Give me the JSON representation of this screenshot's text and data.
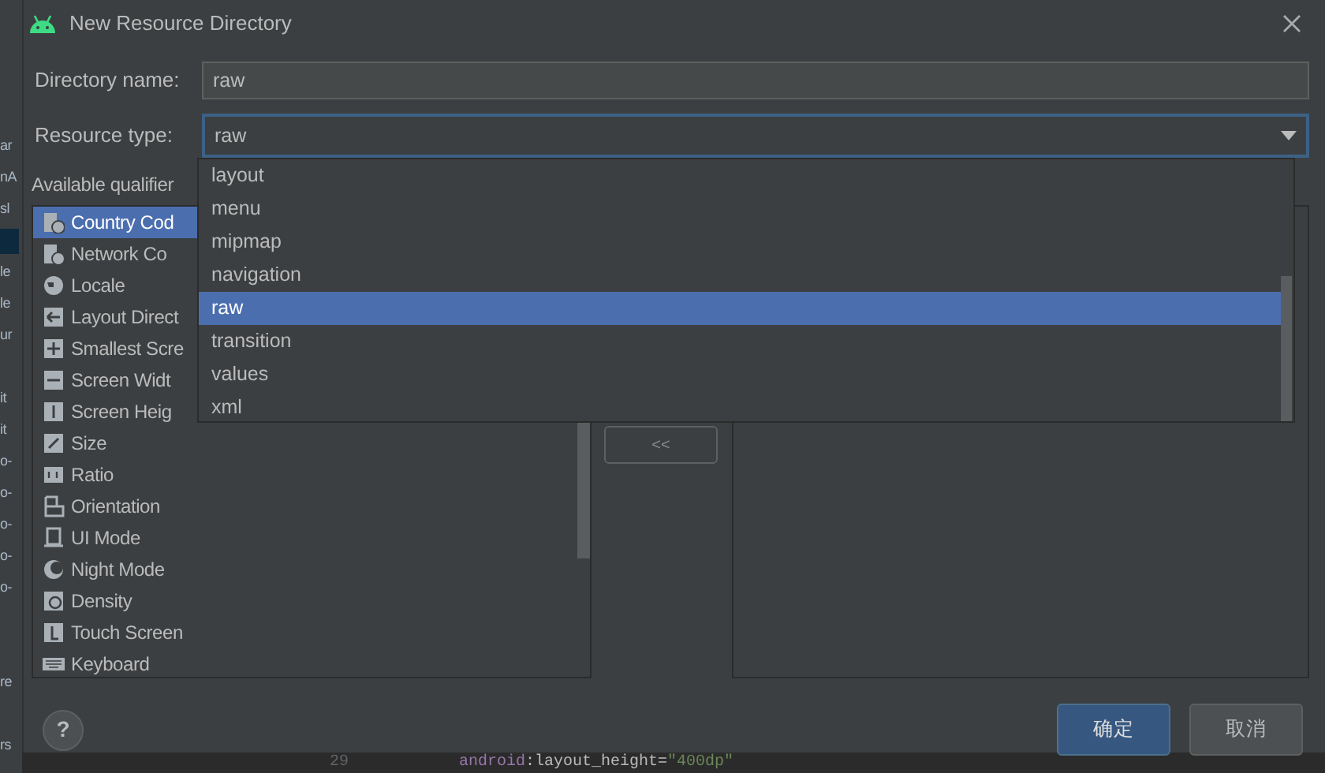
{
  "window": {
    "title": "New Resource Directory"
  },
  "background_fragments": [
    "ar",
    "nA",
    "sl",
    "le",
    "le",
    "ur",
    "it",
    "it",
    "o-",
    "o-",
    "o-",
    "o-",
    "o-",
    "re",
    "rs"
  ],
  "fields": [
    {
      "kind": "text",
      "label": "Directory name:",
      "value": "raw",
      "focused": false
    },
    {
      "kind": "dropdown",
      "label": "Resource type:",
      "value": "raw",
      "focused": true
    }
  ],
  "qualifiers_label": "Available qualifier",
  "qualifiers": [
    {
      "label": "Country Cod",
      "selected": true
    },
    {
      "label": "Network Co",
      "selected": false
    },
    {
      "label": "Locale",
      "selected": false
    },
    {
      "label": "Layout Direct",
      "selected": false
    },
    {
      "label": "Smallest Scre",
      "selected": false
    },
    {
      "label": "Screen Widt",
      "selected": false
    },
    {
      "label": "Screen Heig",
      "selected": false
    },
    {
      "label": "Size",
      "selected": false
    },
    {
      "label": "Ratio",
      "selected": false
    },
    {
      "label": "Orientation",
      "selected": false
    },
    {
      "label": "UI Mode",
      "selected": false
    },
    {
      "label": "Night Mode",
      "selected": false
    },
    {
      "label": "Density",
      "selected": false
    },
    {
      "label": "Touch Screen",
      "selected": false
    },
    {
      "label": "Keyboard",
      "selected": false
    }
  ],
  "remove_button": "<<",
  "resource_type_options": [
    {
      "label": "layout",
      "selected": false
    },
    {
      "label": "menu",
      "selected": false
    },
    {
      "label": "mipmap",
      "selected": false
    },
    {
      "label": "navigation",
      "selected": false
    },
    {
      "label": "raw",
      "selected": true
    },
    {
      "label": "transition",
      "selected": false
    },
    {
      "label": "values",
      "selected": false
    },
    {
      "label": "xml",
      "selected": false
    }
  ],
  "help_button": "?",
  "buttons": [
    {
      "label": "确定",
      "kind": "primary"
    },
    {
      "label": "取消",
      "kind": "secondary"
    }
  ],
  "editor_line": {
    "line_number": "29",
    "namespace": "android",
    "attribute": ":layout_height=",
    "value": "\"400dp\""
  }
}
